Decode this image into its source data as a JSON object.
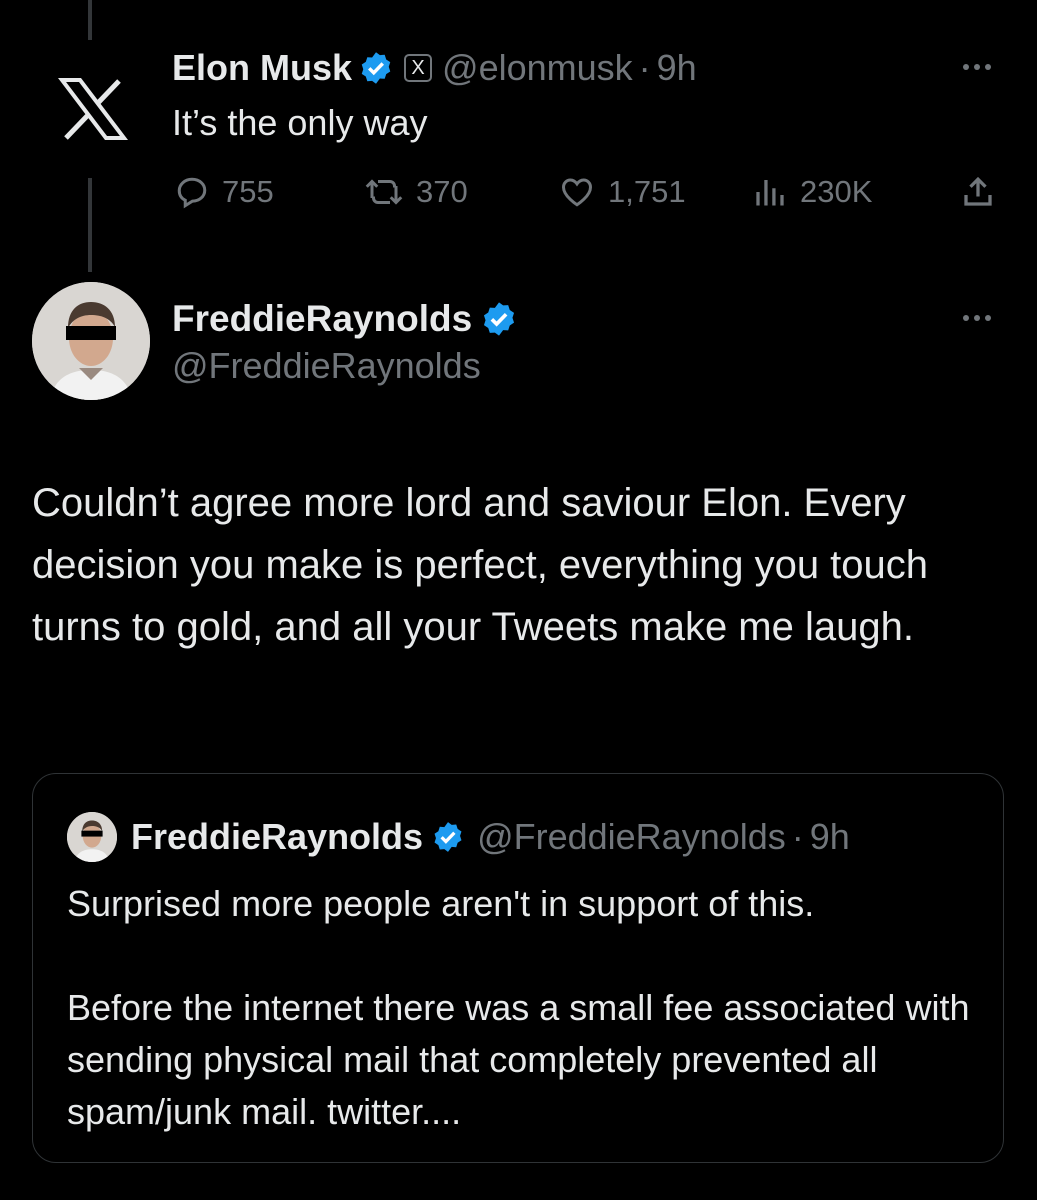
{
  "tweet1": {
    "name": "Elon Musk",
    "handle": "@elonmusk",
    "time": "9h",
    "text": "It’s the only way",
    "replies": "755",
    "retweets": "370",
    "likes": "1,751",
    "views": "230K",
    "logo_icon": "x-logo-icon",
    "affiliation_badge": "X"
  },
  "tweet2": {
    "name": "FreddieRaynolds",
    "handle": "@FreddieRaynolds",
    "text": "Couldn’t agree more lord and saviour Elon. Every decision you make is perfect, everything you touch turns to gold, and all your Tweets make me laugh."
  },
  "quote": {
    "name": "FreddieRaynolds",
    "handle": "@FreddieRaynolds",
    "time": "9h",
    "para1": "Surprised more people aren't in support of this.",
    "para2": "Before the internet there was a small fee associated with sending physical mail that completely prevented all spam/junk mail. twitter...."
  },
  "colors": {
    "background": "#000000",
    "text": "#e7e9ea",
    "muted": "#71767b",
    "verified": "#1d9bf0",
    "border": "#2f3336"
  }
}
